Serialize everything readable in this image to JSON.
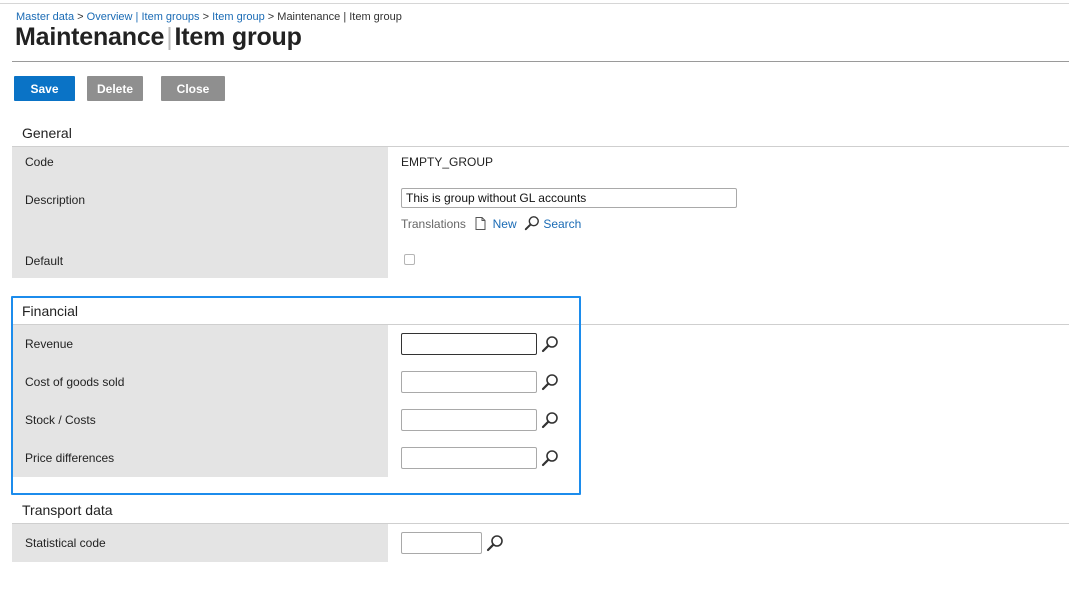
{
  "breadcrumb": {
    "items": [
      "Master data",
      "Overview | Item groups",
      "Item group"
    ],
    "current": "Maintenance | Item group",
    "separator": ">"
  },
  "page": {
    "title_part1": "Maintenance",
    "title_divider": "|",
    "title_part2": "Item group"
  },
  "toolbar": {
    "save_label": "Save",
    "delete_label": "Delete",
    "close_label": "Close"
  },
  "general": {
    "title": "General",
    "code_label": "Code",
    "code_value": "EMPTY_GROUP",
    "description_label": "Description",
    "description_value": "This is group without GL accounts",
    "translations_label": "Translations",
    "new_label": "New",
    "search_label": "Search",
    "default_label": "Default",
    "default_checked": false
  },
  "financial": {
    "title": "Financial",
    "revenue_label": "Revenue",
    "revenue_value": "",
    "cogs_label": "Cost of goods sold",
    "cogs_value": "",
    "stock_label": "Stock / Costs",
    "stock_value": "",
    "price_diff_label": "Price differences",
    "price_diff_value": ""
  },
  "transport": {
    "title": "Transport data",
    "statistical_code_label": "Statistical code",
    "statistical_code_value": ""
  },
  "colors": {
    "primary": "#0a73c6",
    "secondary_button": "#8f8f8f",
    "link": "#1a6bb5",
    "highlight_border": "#1c8cec",
    "label_background": "#e4e4e4"
  }
}
